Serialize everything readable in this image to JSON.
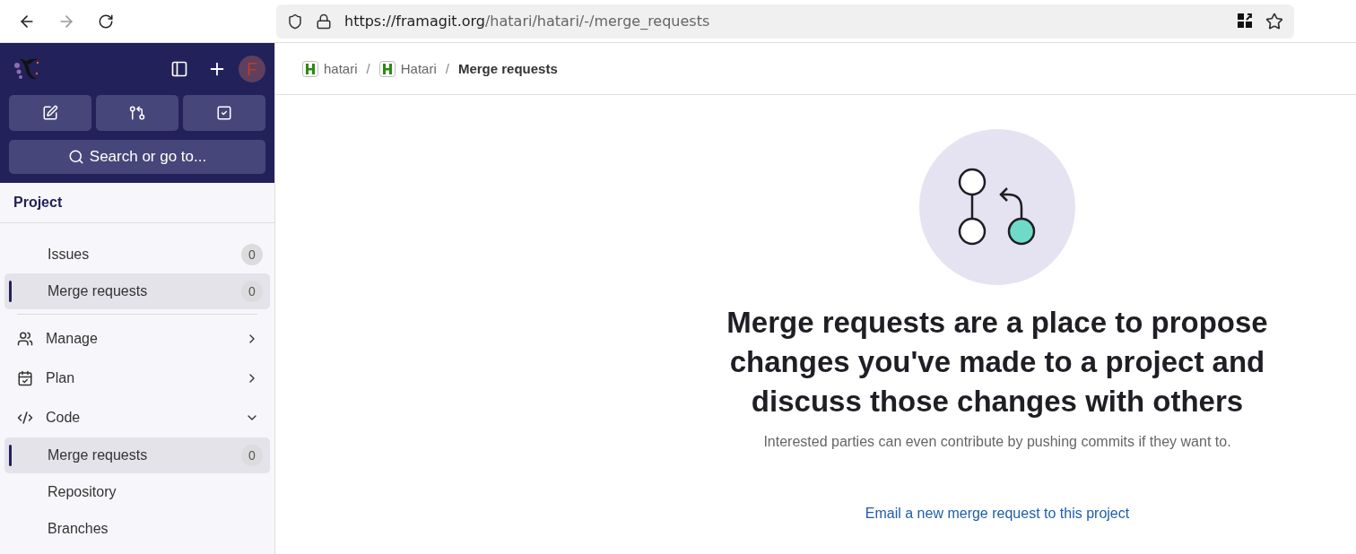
{
  "browser": {
    "url_host": "https://framagit.org",
    "url_path": "/hatari/hatari/-/merge_requests"
  },
  "sidebar": {
    "avatar": "F",
    "search": {
      "placeholder": "Search or go to..."
    },
    "context": "Project",
    "pinned": [
      {
        "label": "Issues",
        "count": "0",
        "selected": false
      },
      {
        "label": "Merge requests",
        "count": "0",
        "selected": true
      }
    ],
    "sections": [
      {
        "kind": "manage",
        "label": "Manage",
        "expanded": false
      },
      {
        "kind": "plan",
        "label": "Plan",
        "expanded": false
      },
      {
        "kind": "code",
        "label": "Code",
        "expanded": true,
        "children": [
          {
            "label": "Merge requests",
            "count": "0",
            "selected": true
          },
          {
            "label": "Repository",
            "selected": false
          },
          {
            "label": "Branches",
            "selected": false
          }
        ]
      }
    ]
  },
  "breadcrumbs": [
    {
      "label": "hatari",
      "current": false
    },
    {
      "separator": "/",
      "label": "Hatari",
      "current": false
    },
    {
      "separator": "/",
      "label": "Merge requests",
      "current": true
    }
  ],
  "empty_state": {
    "title": "Merge requests are a place to propose changes you've made to a project and discuss those changes with others",
    "description": "Interested parties can even contribute by pushing commits if they want to.",
    "link": "Email a new merge request to this project"
  }
}
